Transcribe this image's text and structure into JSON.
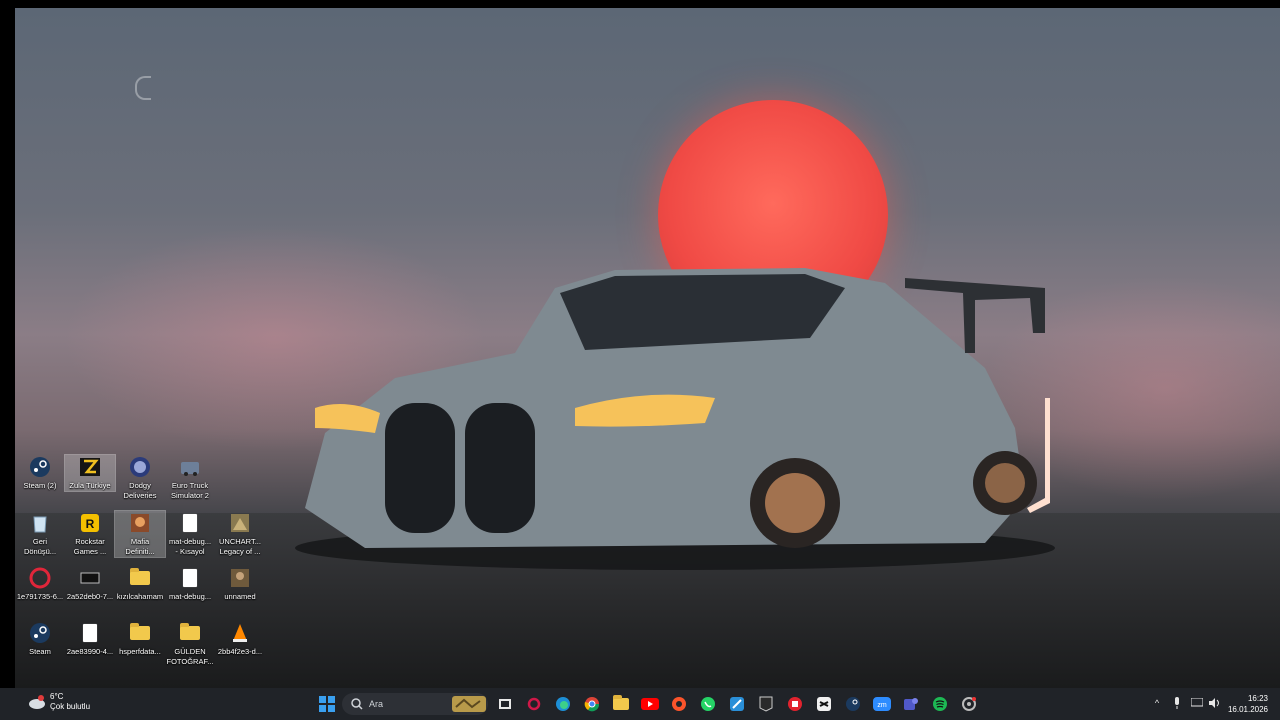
{
  "desktop": {
    "icons": [
      {
        "label": "Steam (2)",
        "icon": "steam-icon"
      },
      {
        "label": "Zula Türkiye",
        "icon": "zula-icon"
      },
      {
        "label": "Dodgy\nDeliveries",
        "icon": "dodgy-deliveries-icon"
      },
      {
        "label": "Euro Truck\nSimulator 2",
        "icon": "euro-truck-icon"
      },
      {
        "label": "Geri\nDönüşü...",
        "icon": "recycle-bin-icon"
      },
      {
        "label": "Rockstar\nGames ...",
        "icon": "rockstar-icon"
      },
      {
        "label": "Mafia\nDefiniti...",
        "icon": "mafia-icon"
      },
      {
        "label": "mat-debug...\n- Kısayol",
        "icon": "document-shortcut-icon"
      },
      {
        "label": "UNCHART...\nLegacy of ...",
        "icon": "uncharted-icon"
      },
      {
        "label": "1e791735-6...",
        "icon": "opera-icon"
      },
      {
        "label": "2a52deb0-7...",
        "icon": "image-file-icon"
      },
      {
        "label": "kızılcahamam",
        "icon": "folder-icon"
      },
      {
        "label": "mat-debug...",
        "icon": "document-icon"
      },
      {
        "label": "unnamed",
        "icon": "image-thumbnail-icon"
      },
      {
        "label": "Steam",
        "icon": "steam-icon"
      },
      {
        "label": "2ae83990-4...",
        "icon": "document-icon"
      },
      {
        "label": "hsperfdata...",
        "icon": "folder-icon"
      },
      {
        "label": "GÜLDEN\nFOTOĞRAF...",
        "icon": "folder-icon"
      },
      {
        "label": "2bb4f2e3-d...",
        "icon": "vlc-icon"
      }
    ]
  },
  "taskbar": {
    "weather": {
      "temp": "6°C",
      "condition": "Çok bulutlu"
    },
    "search_placeholder": "Ara",
    "apps": [
      "windows-start-icon",
      "task-view-icon",
      "opera-gx-icon",
      "edge-icon",
      "chrome-icon",
      "file-explorer-icon",
      "youtube-icon",
      "brave-icon",
      "whatsapp-icon",
      "snipping-tool-icon",
      "epic-games-icon",
      "app-red-icon",
      "capcut-icon",
      "steam-icon",
      "zoom-icon",
      "teams-icon",
      "spotify-icon",
      "settings-icon"
    ],
    "clock": {
      "time": "16:23",
      "date": "16.01.2026"
    }
  }
}
